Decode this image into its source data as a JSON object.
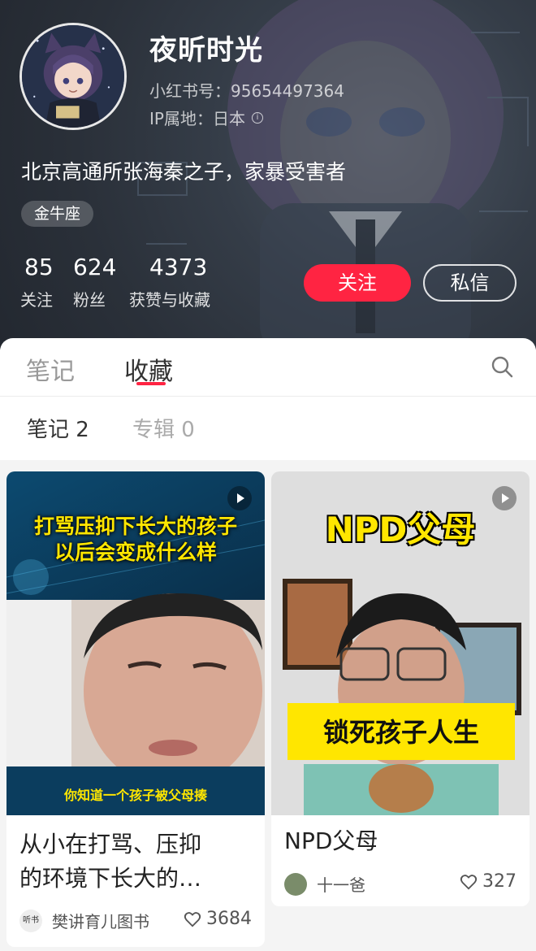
{
  "profile": {
    "nickname": "夜昕时光",
    "account_id": "小红书号：95654497364",
    "ip_location": "IP属地：日本",
    "bio": "北京高通所张海秦之子，家暴受害者",
    "tag": "金牛座",
    "stats": [
      {
        "value": "85",
        "label": "关注"
      },
      {
        "value": "624",
        "label": "粉丝"
      },
      {
        "value": "4373",
        "label": "获赞与收藏"
      }
    ],
    "follow_label": "关注",
    "message_label": "私信"
  },
  "tabs": {
    "notes": "笔记",
    "collections": "收藏"
  },
  "subtabs": {
    "notes": "笔记 2",
    "albums": "专辑 0"
  },
  "cards": [
    {
      "overlay_headline_line1": "打骂压抑下长大的孩子",
      "overlay_headline_line2": "以后会变成什么样",
      "overlay_caption": "你知道一个孩子被父母揍",
      "title_line1": "从小在打骂、压抑",
      "title_line2": "的环境下长大的…",
      "author": "樊讲育儿图书",
      "author_badge": "听书",
      "likes": "3684"
    },
    {
      "overlay_headline": "NPD父母",
      "overlay_caption": "锁死孩子人生",
      "title": "NPD父母",
      "author": "十一爸",
      "likes": "327"
    }
  ],
  "colors": {
    "accent": "#ff2442",
    "header_bg": "#2f3540"
  }
}
